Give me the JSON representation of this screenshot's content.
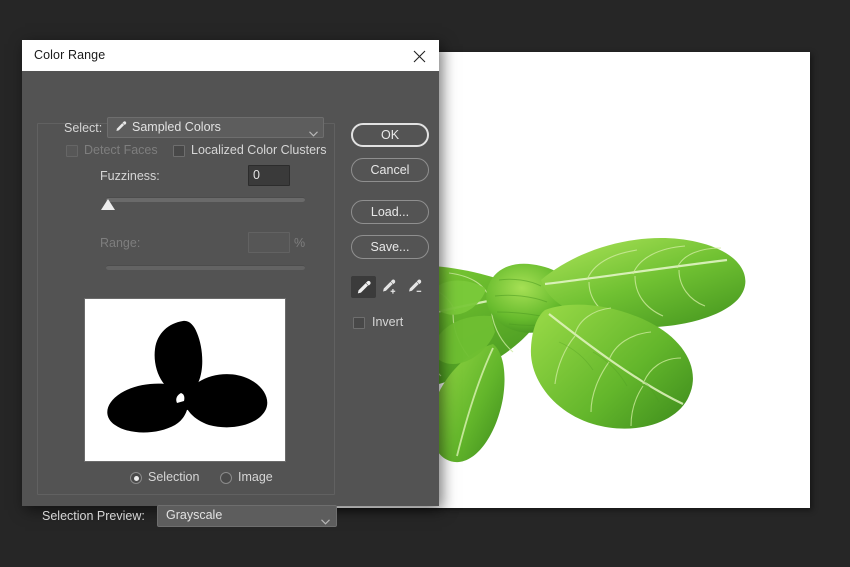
{
  "dialog": {
    "title": "Color Range",
    "close_icon": "close-icon",
    "select": {
      "label": "Select:",
      "value": "Sampled Colors",
      "icon": "eyedropper-icon",
      "arrow_icon": "chevron-down-icon"
    },
    "detect_faces": {
      "label": "Detect Faces",
      "checked": false,
      "disabled": true
    },
    "localized_color_clusters": {
      "label": "Localized Color Clusters",
      "checked": false
    },
    "fuzziness": {
      "label": "Fuzziness:",
      "value": "0",
      "slider_position_pct": 0
    },
    "range": {
      "label": "Range:",
      "value": "",
      "unit": "%",
      "disabled": true,
      "slider_position_pct": 0
    },
    "preview": {
      "mode_selection": {
        "label": "Selection",
        "checked": true
      },
      "mode_image": {
        "label": "Image",
        "checked": false
      }
    },
    "selection_preview": {
      "label": "Selection Preview:",
      "value": "Grayscale",
      "arrow_icon": "chevron-down-icon"
    },
    "buttons": {
      "ok": "OK",
      "cancel": "Cancel",
      "load": "Load...",
      "save": "Save..."
    },
    "tools": {
      "eyedropper": "eyedropper-icon",
      "eyedropper_add": "eyedropper-plus-icon",
      "eyedropper_subtract": "eyedropper-minus-icon",
      "active": "eyedropper"
    },
    "invert": {
      "label": "Invert",
      "checked": false
    }
  },
  "colors": {
    "app_background": "#262626",
    "dialog_background": "#535353",
    "titlebar_background": "#ffffff",
    "text": "#d6d6d6",
    "text_disabled": "#7e7e7e",
    "input_background": "#3a3a3a",
    "canvas_background": "#ffffff",
    "leaf_green_light": "#86cc3a",
    "leaf_green_mid": "#5fb32a",
    "leaf_green_dark": "#3f8f1e",
    "stem_brown": "#7a4430"
  },
  "document": {
    "subject": "mint-sprig-photo",
    "background": "white"
  }
}
